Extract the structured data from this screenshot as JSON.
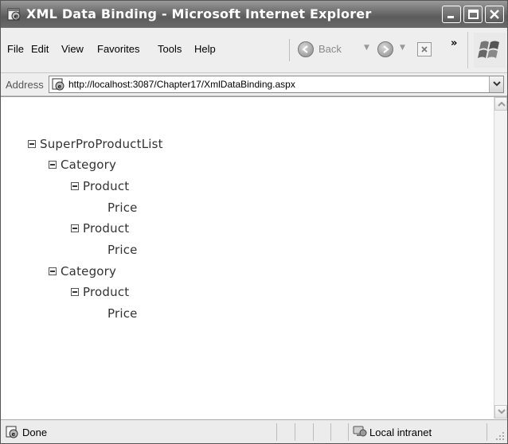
{
  "window": {
    "title": "XML Data Binding - Microsoft Internet Explorer"
  },
  "menu": {
    "items": [
      {
        "label": "File"
      },
      {
        "label": "Edit"
      },
      {
        "label": "View"
      },
      {
        "label": "Favorites"
      },
      {
        "label": "Tools"
      },
      {
        "label": "Help"
      }
    ]
  },
  "toolbar": {
    "back_label": "Back",
    "back_icon": "back-arrow-icon",
    "forward_icon": "forward-arrow-icon",
    "stop_icon": "stop-icon",
    "overflow": "»"
  },
  "address": {
    "label": "Address",
    "url": "http://localhost:3087/Chapter17/XmlDataBinding.aspx"
  },
  "tree": {
    "root": "SuperProProductList",
    "categories": [
      {
        "label": "Category",
        "products": [
          {
            "label": "Product",
            "child": "Price"
          },
          {
            "label": "Product",
            "child": "Price"
          }
        ]
      },
      {
        "label": "Category",
        "products": [
          {
            "label": "Product",
            "child": "Price"
          }
        ]
      }
    ]
  },
  "status": {
    "text": "Done",
    "zone": "Local intranet"
  }
}
